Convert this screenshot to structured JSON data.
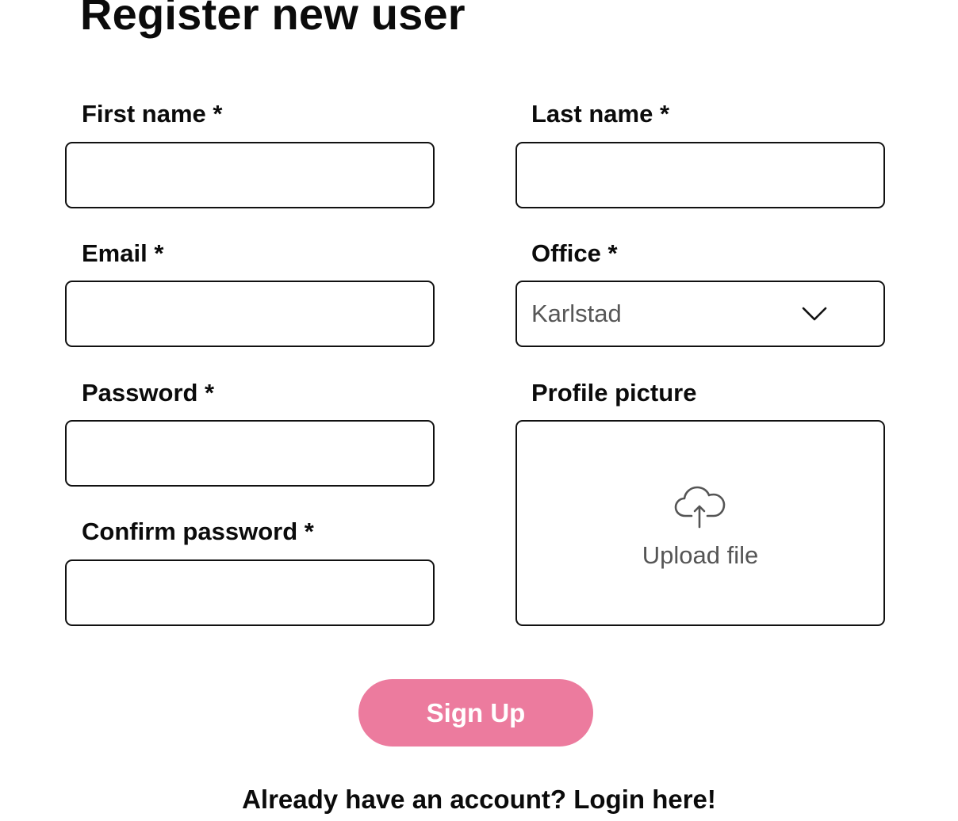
{
  "page": {
    "title": "Register new user"
  },
  "form": {
    "first_name": {
      "label": "First name *",
      "value": ""
    },
    "last_name": {
      "label": "Last name *",
      "value": ""
    },
    "email": {
      "label": "Email *",
      "value": ""
    },
    "office": {
      "label": "Office *",
      "selected": "Karlstad"
    },
    "password": {
      "label": "Password *",
      "value": ""
    },
    "profile_picture": {
      "label": "Profile picture",
      "upload_text": "Upload file"
    },
    "confirm_password": {
      "label": "Confirm password *",
      "value": ""
    },
    "submit_label": "Sign Up"
  },
  "footer": {
    "prompt": "Already have an account?",
    "login_link": "Login here!"
  },
  "icons": {
    "office_dropdown": "chevron-down-icon",
    "upload": "cloud-upload-icon"
  },
  "colors": {
    "accent": "#ec7b9e",
    "text": "#0b0b0b",
    "muted_text": "#575757",
    "border": "#111111"
  }
}
